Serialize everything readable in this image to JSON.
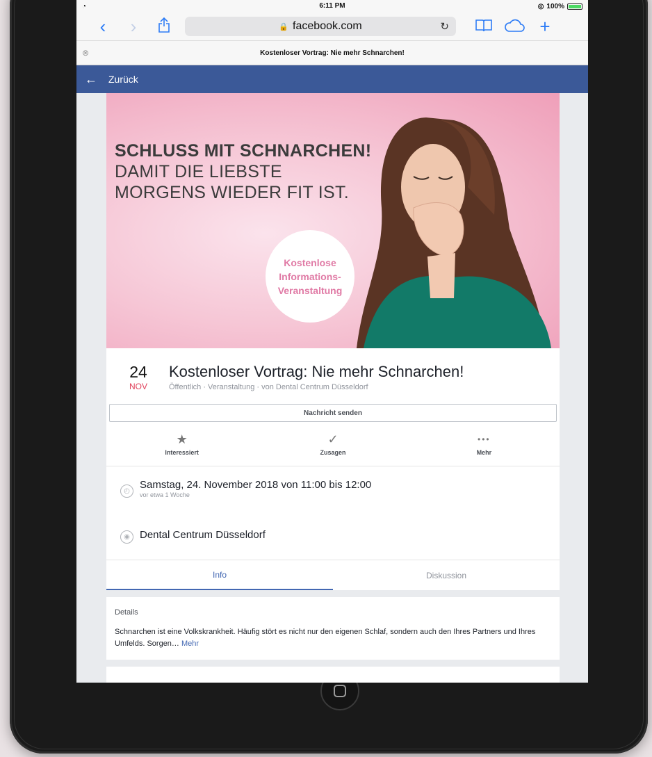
{
  "status": {
    "time": "6:11 PM",
    "battery": "100%"
  },
  "browser": {
    "url": "facebook.com",
    "tab_title": "Kostenloser Vortrag: Nie mehr Schnarchen!"
  },
  "fb": {
    "back_label": "Zurück"
  },
  "banner": {
    "line1": "SCHLUSS MIT SCHNARCHEN!",
    "line2": "DAMIT DIE LIEBSTE",
    "line3": "MORGENS WIEDER FIT IST.",
    "badge": [
      "Kostenlose",
      "Informations-",
      "Veranstaltung"
    ]
  },
  "event": {
    "day": "24",
    "month": "NOV",
    "title": "Kostenloser Vortrag: Nie mehr Schnarchen!",
    "subtitle": "Öffentlich · Veranstaltung · von Dental Centrum Düsseldorf",
    "message_button": "Nachricht senden",
    "actions": [
      {
        "icon": "star-icon",
        "label": "Interessiert"
      },
      {
        "icon": "check-icon",
        "label": "Zusagen"
      },
      {
        "icon": "more-icon",
        "label": "Mehr"
      }
    ],
    "datetime": "Samstag, 24. November 2018 von 11:00 bis 12:00",
    "datetime_sub": "vor etwa 1 Woche",
    "location": "Dental Centrum Düsseldorf"
  },
  "tabs": {
    "info": "Info",
    "discussion": "Diskussion"
  },
  "details": {
    "heading": "Details",
    "text": "Schnarchen ist eine Volkskrankheit. Häufig stört es nicht nur den eigenen Schlaf, sondern auch den Ihres Partners und Ihres Umfelds. Sorgen…",
    "more": "Mehr"
  },
  "colors": {
    "fb_blue": "#3b5998",
    "safari_blue": "#2d7cf6",
    "banner_pink": "#f6c7d6",
    "date_red": "#e0405a"
  }
}
